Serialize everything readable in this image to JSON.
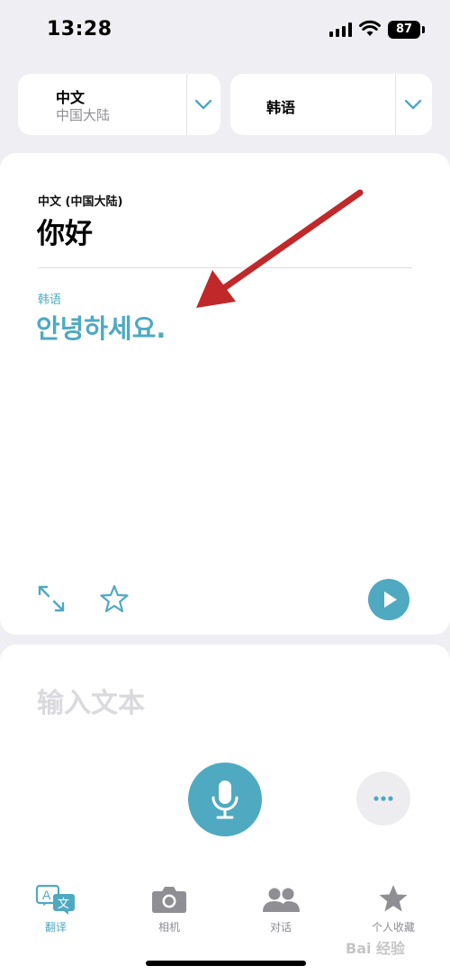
{
  "status_bar": {
    "time": "13:28",
    "battery": "87"
  },
  "language_selector": {
    "source_language": "中文",
    "source_region": "中国大陆",
    "target_language": "韩语"
  },
  "result": {
    "source_label": "中文 (中国大陆)",
    "source_text": "你好",
    "target_label": "韩语",
    "target_text": "안녕하세요."
  },
  "input": {
    "placeholder": "输入文本"
  },
  "tab_bar": {
    "items": [
      {
        "label": "翻译",
        "icon": "translate-icon",
        "active": true
      },
      {
        "label": "相机",
        "icon": "camera-icon",
        "active": false
      },
      {
        "label": "对话",
        "icon": "people-icon",
        "active": false
      },
      {
        "label": "个人收藏",
        "icon": "star-icon",
        "active": false
      }
    ]
  },
  "watermark": "Bai 经验",
  "colors": {
    "accent": "#4fa9c1",
    "annotation_arrow": "#c0282a",
    "background": "#efeff3"
  }
}
